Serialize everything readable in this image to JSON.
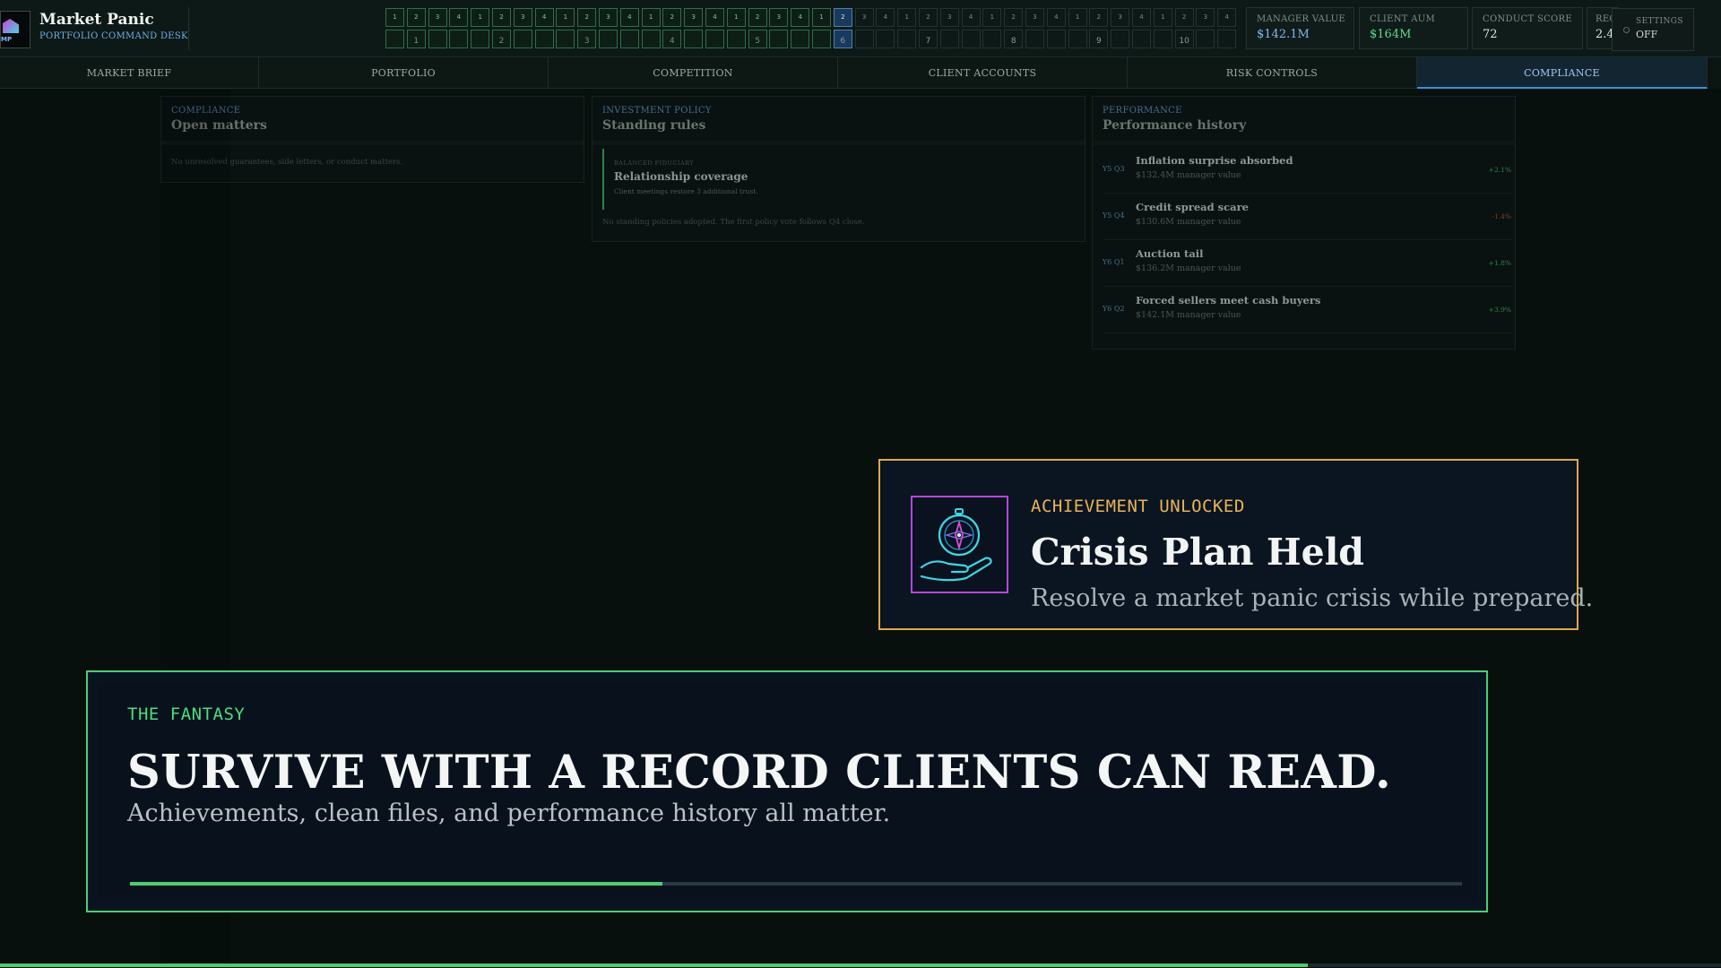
{
  "app": {
    "title": "Market Panic",
    "subtitle": "PORTFOLIO COMMAND DESK",
    "logo_text": "MP"
  },
  "timeline": {
    "top_row": [
      "1",
      "2",
      "3",
      "4",
      "1",
      "2",
      "3",
      "4",
      "1",
      "2",
      "3",
      "4",
      "1",
      "2",
      "3",
      "4",
      "1",
      "2",
      "3",
      "4",
      "1",
      "2",
      "3",
      "4",
      "1",
      "2",
      "3",
      "4",
      "1",
      "2",
      "3",
      "4",
      "1",
      "2",
      "3",
      "4",
      "1",
      "2",
      "3",
      "4"
    ],
    "years": [
      "1",
      "2",
      "3",
      "4",
      "5",
      "6",
      "7",
      "8",
      "9",
      "10"
    ],
    "past_count": 21,
    "current_index": 21
  },
  "stats": [
    {
      "label": "MANAGER VALUE",
      "value": "$142.1M",
      "color": "#7fb9f0"
    },
    {
      "label": "CLIENT AUM",
      "value": "$164M",
      "color": "#5fd98a"
    },
    {
      "label": "CONDUCT SCORE",
      "value": "72",
      "color": "#dfe6e3"
    },
    {
      "label": "REC",
      "value": "2.4",
      "color": "#dfe6e3"
    }
  ],
  "settings": {
    "label": "SETTINGS",
    "value": "OFF"
  },
  "tabs": [
    "MARKET BRIEF",
    "PORTFOLIO",
    "COMPETITION",
    "CLIENT ACCOUNTS",
    "RISK CONTROLS",
    "COMPLIANCE"
  ],
  "active_tab": "COMPLIANCE",
  "compliance_panel": {
    "eyebrow": "COMPLIANCE",
    "title": "Open matters",
    "empty": "No unresolved guarantees, side letters, or conduct matters."
  },
  "policy_panel": {
    "eyebrow": "INVESTMENT POLICY",
    "title": "Standing rules",
    "rule": {
      "tag": "BALANCED FIDUCIARY",
      "name": "Relationship coverage",
      "desc": "Client meetings restore 3 additional trust."
    },
    "empty": "No standing policies adopted. The first policy vote follows Q4 close."
  },
  "performance_panel": {
    "eyebrow": "PERFORMANCE",
    "title": "Performance history",
    "rows": [
      {
        "quarter": "Y5 Q3",
        "headline": "Inflation surprise absorbed",
        "manager_value": "$132.4M manager value",
        "delta": "+2.1%",
        "delta_color": "#4dcc73"
      },
      {
        "quarter": "Y5 Q4",
        "headline": "Credit spread scare",
        "manager_value": "$130.6M manager value",
        "delta": "-1.4%",
        "delta_color": "#e0524d"
      },
      {
        "quarter": "Y6 Q1",
        "headline": "Auction tail",
        "manager_value": "$136.2M manager value",
        "delta": "+1.8%",
        "delta_color": "#4dcc73"
      },
      {
        "quarter": "Y6 Q2",
        "headline": "Forced sellers meet cash buyers",
        "manager_value": "$142.1M manager value",
        "delta": "+3.9%",
        "delta_color": "#4dcc73"
      }
    ]
  },
  "achievement": {
    "eyebrow": "ACHIEVEMENT UNLOCKED",
    "title": "Crisis Plan Held",
    "description": "Resolve a market panic crisis while prepared.",
    "icon": "compass-in-hand-icon"
  },
  "fantasy": {
    "eyebrow": "THE FANTASY",
    "headline": "SURVIVE WITH A RECORD CLIENTS CAN READ.",
    "sub": "Achievements, clean files, and performance history all matter.",
    "progress": 0.4
  },
  "bottom_progress": 0.76
}
